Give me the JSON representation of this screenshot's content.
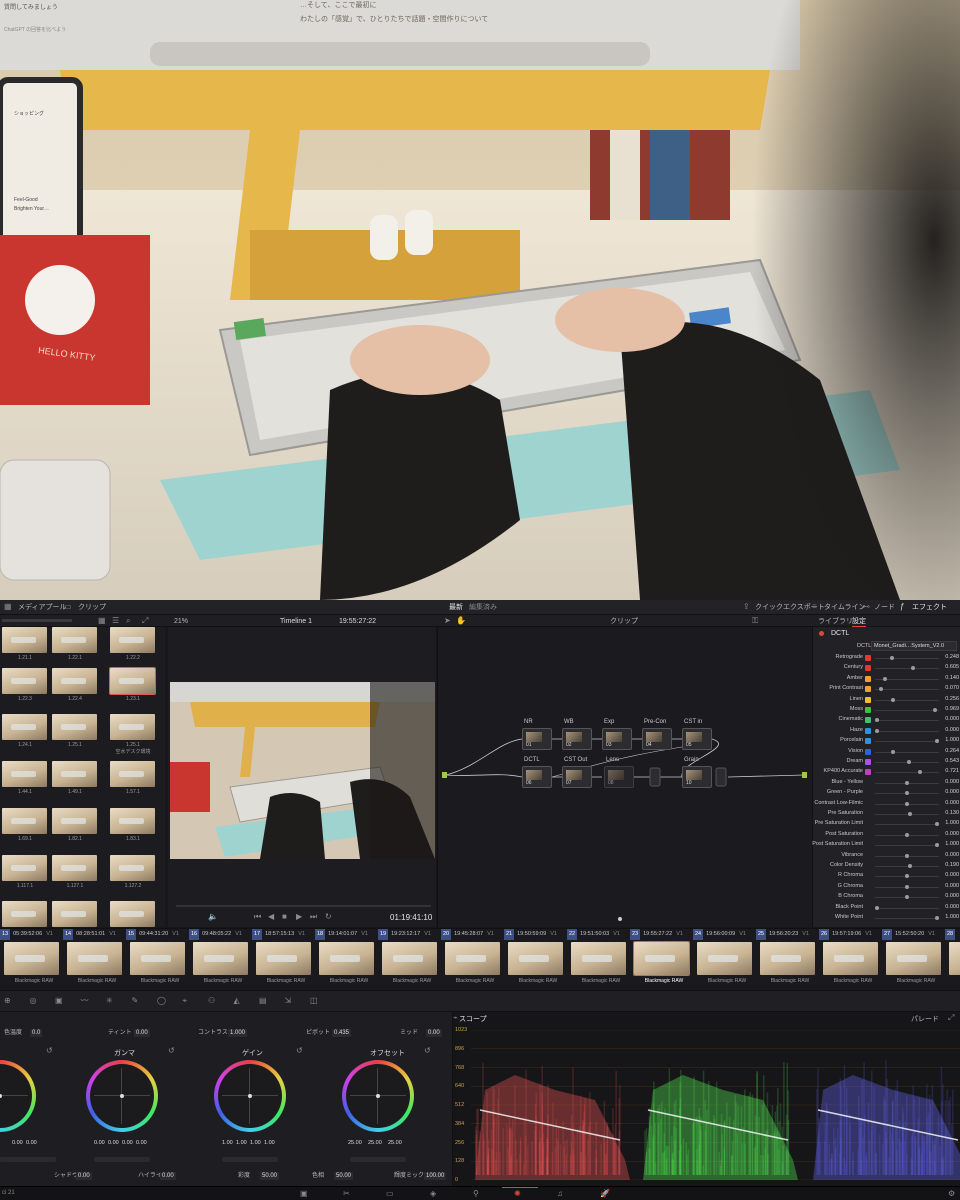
{
  "colors": {
    "accent": "#e0463b",
    "selected_clip": "#e05a5a",
    "node_link": "#9ec94a",
    "track_badge": "#3d4f86"
  },
  "photo": {
    "browser_text_top": "…そして、ここで最初に",
    "browser_text_2": "わたしの「感覚」で、ひとりたちで話題・空間作りについて",
    "sidebar_text_1": "質問してみましょう",
    "sidebar_text_2": "ChatGPT の回答を比べよう",
    "phone_text_1": "ショッピング",
    "phone_text_2": "Feel-Good",
    "phone_text_3": "Brighten Your…",
    "notebook_text": "HELLO KITTY"
  },
  "topbar": {
    "media_pool": "メディアプール",
    "clip": "クリップ",
    "project_title": "最新",
    "project_status": "編集済み",
    "quick_export": "クイックエクスポート",
    "timeline": "タイムライン",
    "nodes": "ノード",
    "effects": "エフェクト"
  },
  "toolbar2": {
    "zoom": "21%",
    "timeline_name": "Timeline 1",
    "timecode": "19:55:27:22",
    "node_mode": "クリップ",
    "library_tab": "ライブラリ",
    "settings_tab": "設定"
  },
  "pool": {
    "clips": [
      "1.21.1",
      "1.22.1",
      "1.22.2",
      "1.22.3",
      "1.22.4",
      "1.23.1",
      "1.24.1",
      "1.25.1",
      "1.25.1\n空水デスク環境",
      "1.44.1",
      "1.49.1",
      "1.57.1",
      "1.69.1",
      "1.82.1",
      "1.83.1",
      "1.117.1",
      "1.127.1",
      "1.127.2",
      "",
      "",
      ""
    ]
  },
  "viewer": {
    "timecode": "01:19:41:10"
  },
  "nodes": {
    "top_row": [
      {
        "label": "NR",
        "num": "01"
      },
      {
        "label": "WB",
        "num": "02"
      },
      {
        "label": "Exp",
        "num": "03"
      },
      {
        "label": "Pre-Con",
        "num": "04"
      },
      {
        "label": "CST in",
        "num": "05"
      }
    ],
    "bottom_row": [
      {
        "label": "DCTL",
        "num": "06"
      },
      {
        "label": "CST Out",
        "num": "07"
      },
      {
        "label": "Lens",
        "num": "08"
      },
      {
        "label": "Grain",
        "num": "10"
      }
    ]
  },
  "settings": {
    "dctl_title": "DCTL",
    "dctl_label": "DCTL",
    "dctl_file": "Monet_Gradi…System_V2.0",
    "params": [
      {
        "name": "Retrograde",
        "value": "0.248",
        "color": "#e03a30",
        "knob": 0.25
      },
      {
        "name": "Century",
        "value": "0.605",
        "color": "#e03a30",
        "knob": 0.6
      },
      {
        "name": "Amber",
        "value": "0.140",
        "color": "#f0a030",
        "knob": 0.14
      },
      {
        "name": "Print Contrast",
        "value": "0.070",
        "color": "#f0a030",
        "knob": 0.07
      },
      {
        "name": "Linen",
        "value": "0.256",
        "color": "#f0c030",
        "knob": 0.26
      },
      {
        "name": "Moss",
        "value": "0.969",
        "color": "#40c040",
        "knob": 0.97
      },
      {
        "name": "Cinematic",
        "value": "0.000",
        "color": "#40c070",
        "knob": 0.0
      },
      {
        "name": "Haze",
        "value": "0.000",
        "color": "#3090e0",
        "knob": 0.0
      },
      {
        "name": "Porcelain",
        "value": "1.000",
        "color": "#3090e0",
        "knob": 1.0
      },
      {
        "name": "Vision",
        "value": "0.264",
        "color": "#3060e0",
        "knob": 0.26
      },
      {
        "name": "Dream",
        "value": "0.543",
        "color": "#b050e0",
        "knob": 0.54
      },
      {
        "name": "KP400 Accurate",
        "value": "0.721",
        "color": "#c040c0",
        "knob": 0.72
      },
      {
        "name": "Blue - Yellow",
        "value": "0.000",
        "color": "",
        "knob": 0.5
      },
      {
        "name": "Green - Purple",
        "value": "0.000",
        "color": "",
        "knob": 0.5
      },
      {
        "name": "Contrast Low-Filmic",
        "value": "0.000",
        "color": "",
        "knob": 0.5
      },
      {
        "name": "Pre Saturation",
        "value": "0.130",
        "color": "",
        "knob": 0.55
      },
      {
        "name": "Pre Saturation Limit",
        "value": "1.000",
        "color": "",
        "knob": 1.0
      },
      {
        "name": "Post Saturation",
        "value": "0.000",
        "color": "",
        "knob": 0.5
      },
      {
        "name": "Post Saturation Limit",
        "value": "1.000",
        "color": "",
        "knob": 1.0
      },
      {
        "name": "Vibrance",
        "value": "0.000",
        "color": "",
        "knob": 0.5
      },
      {
        "name": "Color Density",
        "value": "0.190",
        "color": "",
        "knob": 0.55
      },
      {
        "name": "R Chroma",
        "value": "0.000",
        "color": "",
        "knob": 0.5
      },
      {
        "name": "G Chroma",
        "value": "0.000",
        "color": "",
        "knob": 0.5
      },
      {
        "name": "B Chroma",
        "value": "0.000",
        "color": "",
        "knob": 0.5
      },
      {
        "name": "Black Point",
        "value": "0.000",
        "color": "",
        "knob": 0.0
      },
      {
        "name": "White Point",
        "value": "1.000",
        "color": "",
        "knob": 1.0
      }
    ]
  },
  "strip": {
    "track_label": "V1",
    "codec": "Blackmagic RAW",
    "clips": [
      {
        "num": "13",
        "tc": "05:39:52:06"
      },
      {
        "num": "14",
        "tc": "08:28:51:01"
      },
      {
        "num": "15",
        "tc": "09:44:31:20"
      },
      {
        "num": "16",
        "tc": "09:48:05:22"
      },
      {
        "num": "17",
        "tc": "18:57:15:13"
      },
      {
        "num": "18",
        "tc": "19:14:01:07"
      },
      {
        "num": "19",
        "tc": "19:23:12:17"
      },
      {
        "num": "20",
        "tc": "19:45:28:07"
      },
      {
        "num": "21",
        "tc": "19:50:59:09"
      },
      {
        "num": "22",
        "tc": "19:51:50:03"
      },
      {
        "num": "23",
        "tc": "19:55:27:22"
      },
      {
        "num": "24",
        "tc": "19:56:00:09"
      },
      {
        "num": "25",
        "tc": "19:56:20:23"
      },
      {
        "num": "26",
        "tc": "19:57:19:06"
      },
      {
        "num": "27",
        "tc": "15:52:50:20"
      },
      {
        "num": "28",
        "tc": ""
      }
    ]
  },
  "wheels": {
    "params_top": [
      {
        "label": "色温度",
        "value": "0.0"
      },
      {
        "label": "ティント",
        "value": "0.00"
      },
      {
        "label": "コントラスト",
        "value": "1.000"
      },
      {
        "label": "ピボット",
        "value": "0.435"
      },
      {
        "label": "ミッド",
        "value": "0.00"
      }
    ],
    "wheel_titles": [
      "",
      "ガンマ",
      "ゲイン",
      "オフセット"
    ],
    "wheel_values": [
      [
        "0.00",
        "0.00"
      ],
      [
        "0.00",
        "0.00",
        "0.00",
        "0.00"
      ],
      [
        "1.00",
        "1.00",
        "1.00",
        "1.00"
      ],
      [
        "25.00",
        "25.00",
        "25.00"
      ]
    ],
    "params_bottom": [
      {
        "label": "シャドウ",
        "value": "0.00"
      },
      {
        "label": "ハイライト",
        "value": "0.00"
      },
      {
        "label": "彩度",
        "value": "50.00"
      },
      {
        "label": "色相",
        "value": "50.00"
      },
      {
        "label": "輝度ミックス",
        "value": "100.00"
      }
    ]
  },
  "scope": {
    "title": "スコープ",
    "mode": "パレード",
    "ticks": [
      "1023",
      "896",
      "768",
      "640",
      "512",
      "384",
      "256",
      "128",
      "0"
    ]
  },
  "pages": {
    "left_label": "ci 21"
  }
}
